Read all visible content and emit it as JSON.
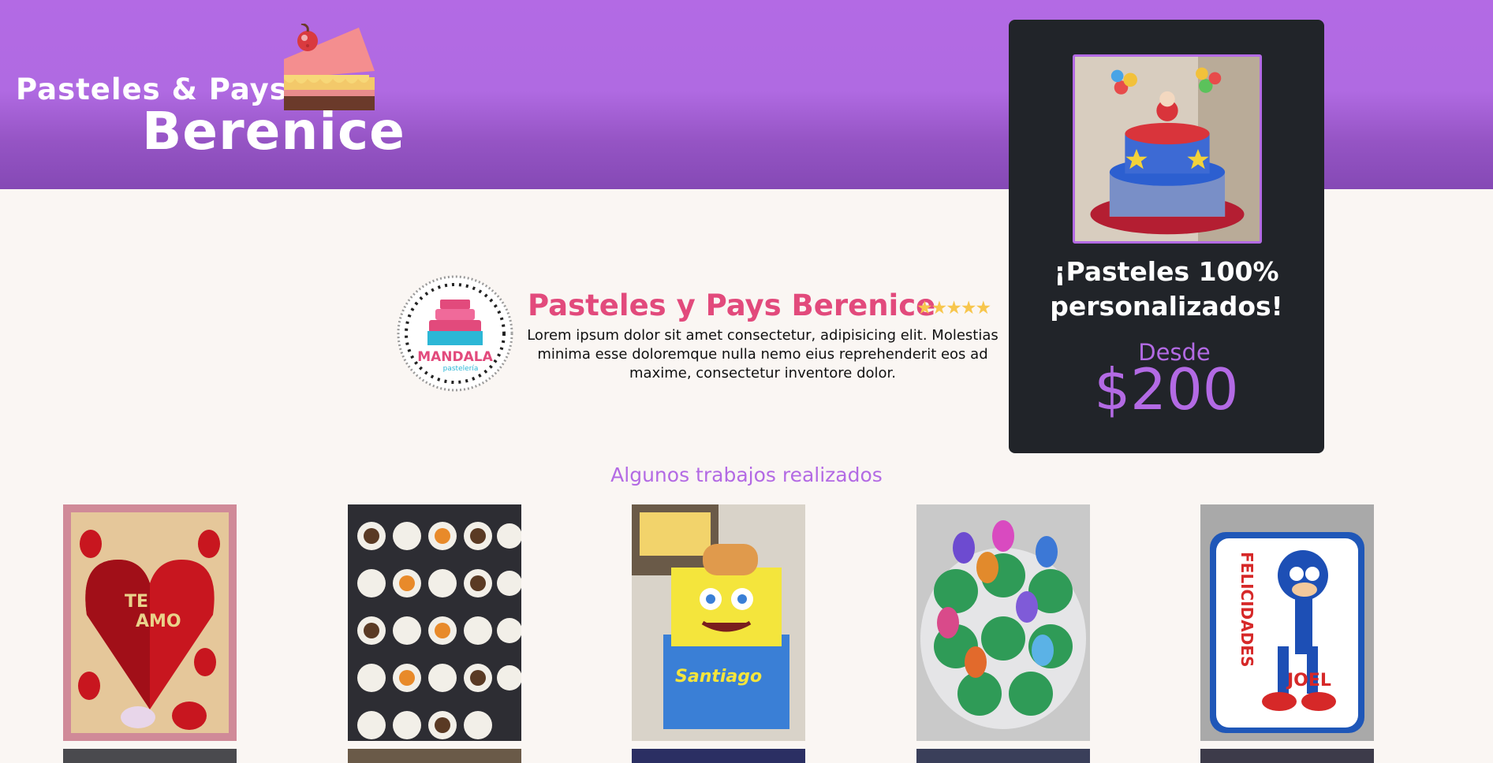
{
  "header": {
    "logo_line1": "Pasteles & Pays",
    "logo_line2": "Berenice",
    "logo_icon": "cake-slice-icon"
  },
  "promo": {
    "title_line1": "¡Pasteles 100%",
    "title_line2": "personalizados!",
    "from_label": "Desde",
    "price": "$200",
    "image_icon": "circus-cake-photo"
  },
  "about": {
    "badge_icon": "mandala-pasteleria-badge",
    "badge_text": "MANDALA",
    "badge_subtext": "pastelería",
    "title": "Pasteles y Pays Berenice",
    "stars": "★★★★★",
    "rating": 5,
    "text": "Lorem ipsum dolor sit amet consectetur, adipisicing elit. Molestias minima esse doloremque nulla nemo eius reprehenderit eos ad maxime, consectetur inventore dolor."
  },
  "gallery": {
    "title": "Algunos trabajos realizados",
    "items": [
      {
        "name": "heart-chocolate-box-photo",
        "caption1": "TE",
        "caption2": "AMO"
      },
      {
        "name": "cupcake-tray-photo"
      },
      {
        "name": "spongebob-cake-photo",
        "caption": "Santiago"
      },
      {
        "name": "cupcakes-toys-photo"
      },
      {
        "name": "sonic-cake-photo",
        "caption1": "FELICIDADES",
        "caption2": "JOEL"
      }
    ]
  },
  "colors": {
    "header": "#b36ae4",
    "accent_pink": "#e24a7c",
    "accent_purple": "#b36ae4",
    "promo_bg": "#212429",
    "page_bg": "#faf6f3"
  }
}
